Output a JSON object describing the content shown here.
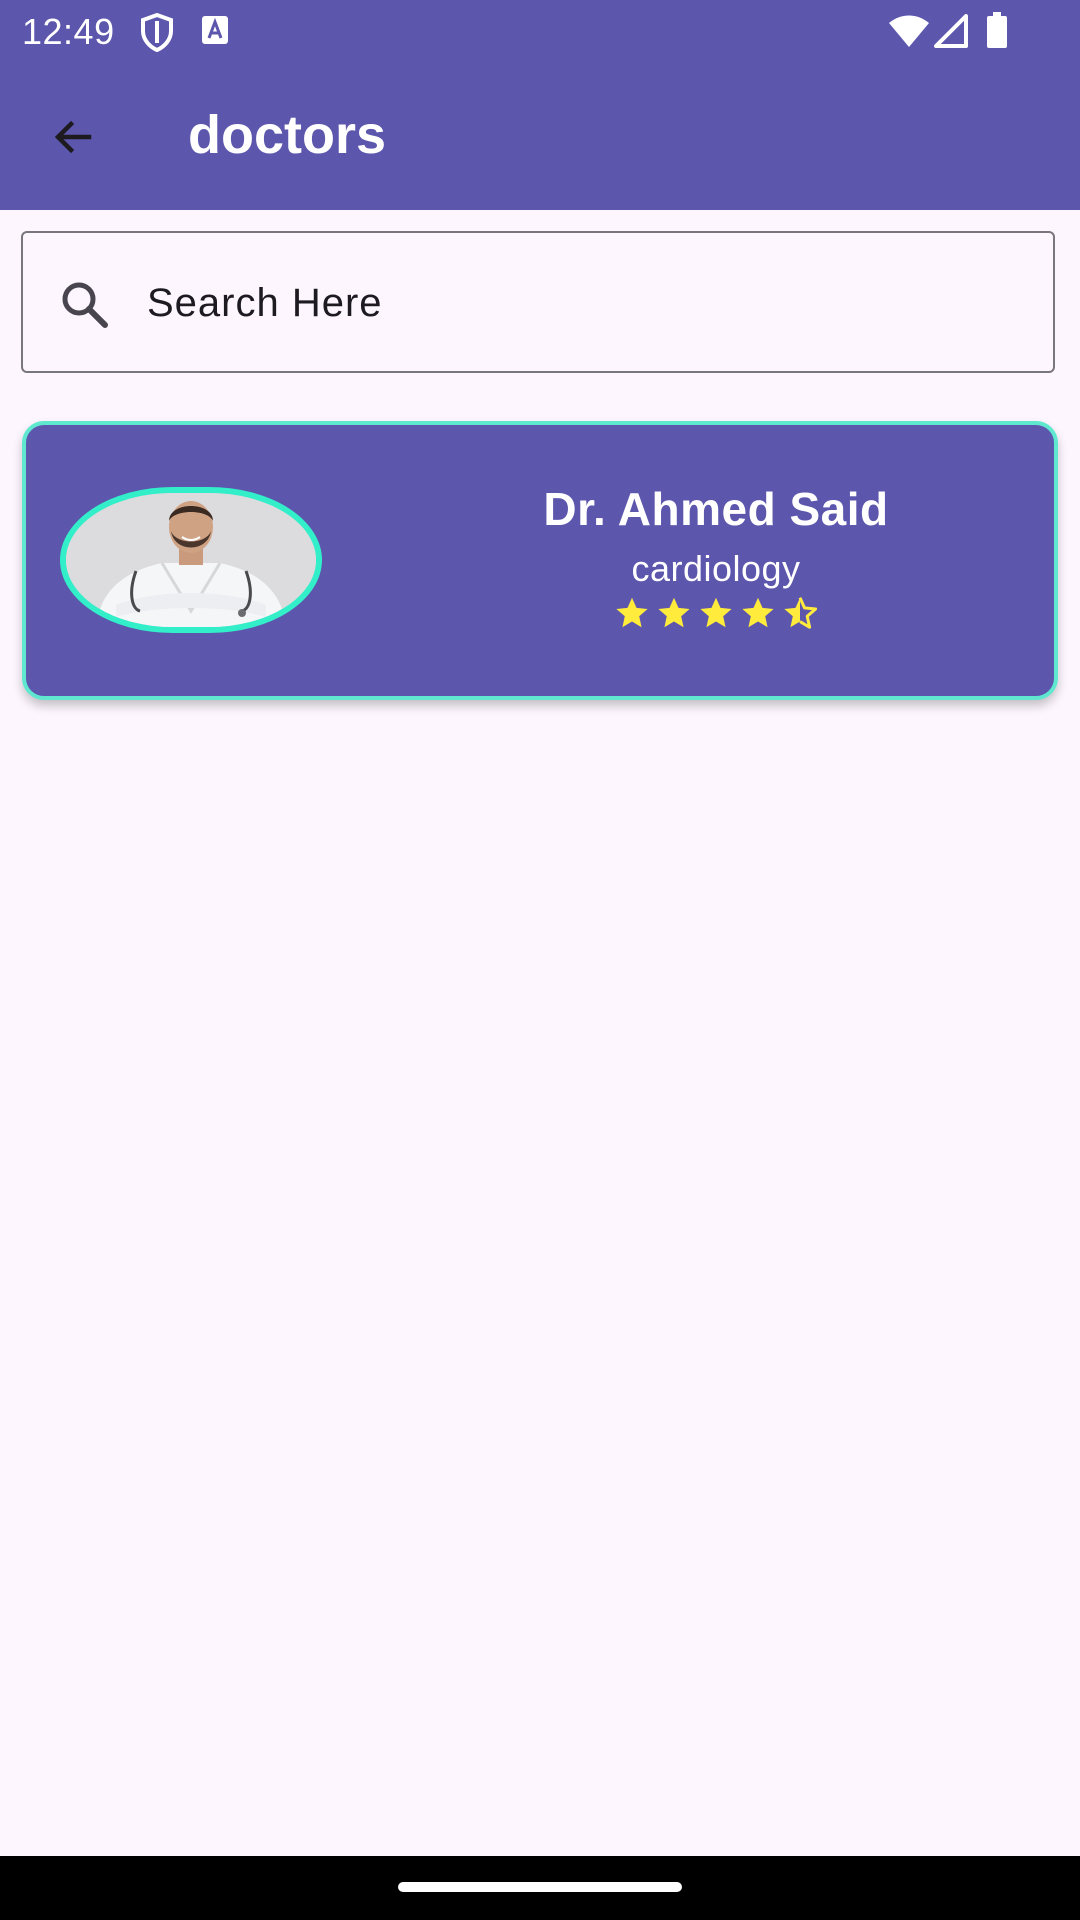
{
  "status_bar": {
    "time": "12:49",
    "icons": [
      "shield-icon",
      "a-badge-icon",
      "wifi-icon",
      "signal-icon",
      "battery-icon"
    ]
  },
  "app_bar": {
    "back_icon": "arrow-back-icon",
    "title": "doctors"
  },
  "search": {
    "icon": "search-icon",
    "placeholder": "Search Here",
    "value": ""
  },
  "doctors": [
    {
      "name": "Dr. Ahmed Said",
      "specialty": "cardiology",
      "rating": 4.5,
      "rating_max": 5
    }
  ],
  "colors": {
    "primary": "#5c56ad",
    "background": "#fdf6fe",
    "card_border": "#5fe8cf",
    "photo_border": "#33efc9",
    "star": "#ffeb3b",
    "text_on_primary": "#ffffff"
  }
}
